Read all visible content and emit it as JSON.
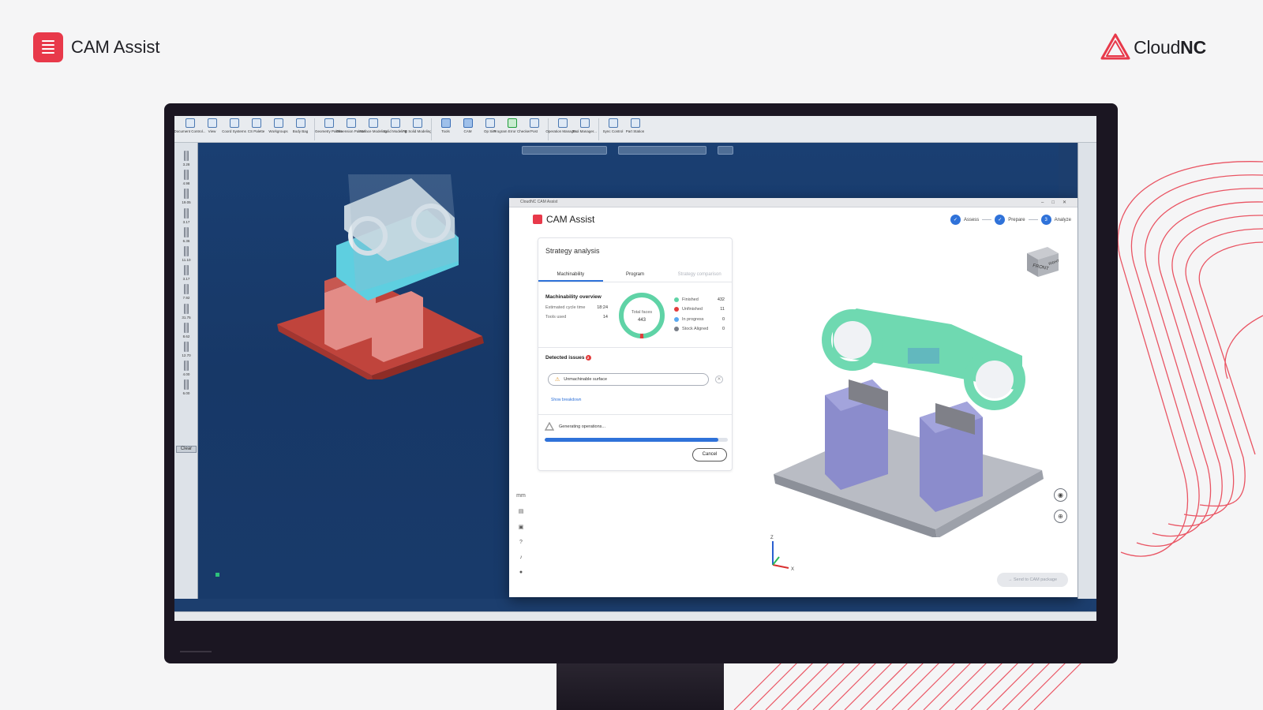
{
  "brand": {
    "product_name": "CAM Assist",
    "company_prefix": "Cloud",
    "company_suffix": "NC"
  },
  "colors": {
    "accent_red": "#e8394a",
    "primary_blue": "#2f72d9",
    "finished": "#5fd3a6",
    "unfinished": "#e33b3b",
    "in_progress": "#58a8f0",
    "stock_aligned": "#7a7f88"
  },
  "cad": {
    "ribbon": [
      {
        "label": "Document Control...",
        "icon": "document-icon"
      },
      {
        "label": "View",
        "icon": "view-icon"
      },
      {
        "label": "Coord Systems",
        "icon": "coord-icon"
      },
      {
        "label": "CS Palette",
        "icon": "palette-icon"
      },
      {
        "label": "Workgroups",
        "icon": "workgroups-icon"
      },
      {
        "label": "Body Bag",
        "icon": "bodybag-icon"
      },
      {
        "label": "Geometry Palette",
        "icon": "geometry-icon"
      },
      {
        "label": "Dimension Palette",
        "icon": "dimension-icon"
      },
      {
        "label": "Surface Modeling",
        "icon": "surface-icon"
      },
      {
        "label": "Solid Modeling",
        "icon": "solid-icon"
      },
      {
        "label": "FB Solid Modeling",
        "icon": "fbsolid-icon"
      },
      {
        "label": "Tools",
        "icon": "tools-icon"
      },
      {
        "label": "CAM",
        "icon": "cam-icon"
      },
      {
        "label": "Op Sim",
        "icon": "opsim-icon"
      },
      {
        "label": "Program Error Checker",
        "icon": "checker-icon"
      },
      {
        "label": "Post",
        "icon": "post-icon"
      },
      {
        "label": "Operation Manager...",
        "icon": "opmanager-icon"
      },
      {
        "label": "Tool Manager...",
        "icon": "toolmanager-icon"
      },
      {
        "label": "Sync Control",
        "icon": "sync-icon"
      },
      {
        "label": "Part Station",
        "icon": "partstation-icon"
      }
    ],
    "tool_numbers": [
      "3.28",
      "4.98",
      "19.05",
      "3.17",
      "6.36",
      "11.10",
      "3.17",
      "7.92",
      "31.75",
      "8.62",
      "12.70",
      "4.00",
      "6.00"
    ],
    "clear_label": "Clear"
  },
  "cam": {
    "window_title": "CloudNC CAM Assist",
    "app_title": "CAM Assist",
    "steps": [
      {
        "num": "✓",
        "label": "Assess"
      },
      {
        "num": "✓",
        "label": "Prepare"
      },
      {
        "num": "3",
        "label": "Analyze"
      }
    ],
    "card_title": "Strategy analysis",
    "tabs": [
      "Machinability",
      "Program",
      "Strategy comparison"
    ],
    "overview_title": "Machinability overview",
    "estimated_cycle_label": "Estimated cycle time",
    "estimated_cycle_value": "18:24",
    "tools_used_label": "Tools used",
    "tools_used_value": "14",
    "donut_label": "Total faces",
    "donut_value": "443",
    "legend": [
      {
        "label": "Finished",
        "value": 432
      },
      {
        "label": "Unfinished",
        "value": 11
      },
      {
        "label": "In progress",
        "value": 0
      },
      {
        "label": "Stock Aligned",
        "value": 0
      }
    ],
    "issues_title": "Detected issues",
    "issues_count": "2",
    "issue_label": "Unmachinable surface",
    "show_breakdown": "Show breakdown",
    "generating_label": "Generating operations...",
    "progress_percent": 95,
    "cancel_label": "Cancel",
    "unit_label": "mm",
    "send_label": "Send to CAM package",
    "viewcube_front": "FRONT",
    "viewcube_right": "RIGHT",
    "axis_z": "Z",
    "axis_x": "X"
  }
}
